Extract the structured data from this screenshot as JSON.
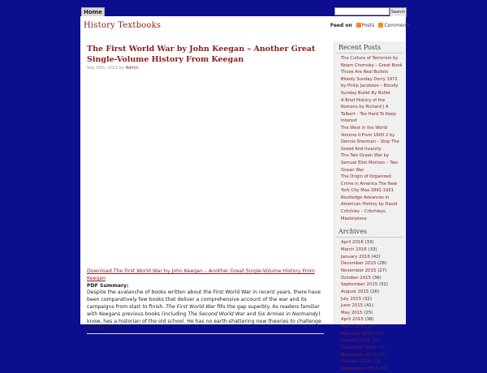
{
  "nav": {
    "home_label": "Home",
    "search_button_label": "Search"
  },
  "header": {
    "site_title": "History Textbooks",
    "feed_label": "Feed on",
    "posts_label": "Posts",
    "comments_label": "Comments"
  },
  "post": {
    "title": "The First World War by John Keegan – Another Great Single-Volume History From Keegan",
    "date": "Sep 26th, 2011",
    "by": "by",
    "author": "Admin",
    "download_link": "Download The First World War by John Keegan – Another Great Single-Volume History From Keegan",
    "summary_label": "PDF Summary:",
    "summary_part1": "Despite the avalanche of books written about the First World War in recent years, there have been comparatively few books that deliver a comprehensive account of the war and its campaigns from start to finish.",
    "summary_em1": "The First World War",
    "summary_part2": "fills the gap superbly. As readers familiar with Keegans previous books (including",
    "summary_em2": "The Second World War",
    "summary_and": "and",
    "summary_em3": "Six Armies in Normandy",
    "summary_part3": ") know, hes a historian of the old school. He has no earth-shattering new theories to challenge the status quo..."
  },
  "sidebar": {
    "recent_title": "Recent Posts",
    "recent_posts": [
      "The Culture of Terrorism by Noam Chomsky – Great Book",
      "Those Are Real Bullets Bloody Sunday Derry 1972 by Philip Jacobson – Bloody Sunday Bullet By Bullet",
      "A Brief History of the Romans by Richard J A Talbert – Too Hard To Keep Interest",
      "The West in the World Volume II From 1600 2 by Dennis Sherman – Stop The Greed And Insanity",
      "The Two Ocean War by Samuel Eliot Morison – Two Ocean War",
      "The Origin of Organized Crime in America The New York City Maa 1891-1931 Routledge Advances in American History by David Critchley – Critchleys Masterpiece"
    ],
    "archives_title": "Archives",
    "archives": [
      {
        "month": "April 2016",
        "count": "(33)"
      },
      {
        "month": "March 2016",
        "count": "(33)"
      },
      {
        "month": "January 2016",
        "count": "(42)"
      },
      {
        "month": "December 2015",
        "count": "(28)"
      },
      {
        "month": "November 2015",
        "count": "(27)"
      },
      {
        "month": "October 2015",
        "count": "(36)"
      },
      {
        "month": "September 2015",
        "count": "(32)"
      },
      {
        "month": "August 2015",
        "count": "(26)"
      },
      {
        "month": "July 2015",
        "count": "(32)"
      },
      {
        "month": "June 2015",
        "count": "(41)"
      },
      {
        "month": "May 2015",
        "count": "(25)"
      },
      {
        "month": "April 2015",
        "count": "(38)"
      },
      {
        "month": "March 2015",
        "count": "(37)"
      },
      {
        "month": "February 2015",
        "count": "(44)"
      },
      {
        "month": "January 2015",
        "count": "(52)"
      },
      {
        "month": "December 2014",
        "count": "(52)"
      },
      {
        "month": "November 2014",
        "count": "(32)"
      },
      {
        "month": "October 2014",
        "count": "(39)"
      },
      {
        "month": "September 2014",
        "count": "(69)"
      }
    ]
  }
}
